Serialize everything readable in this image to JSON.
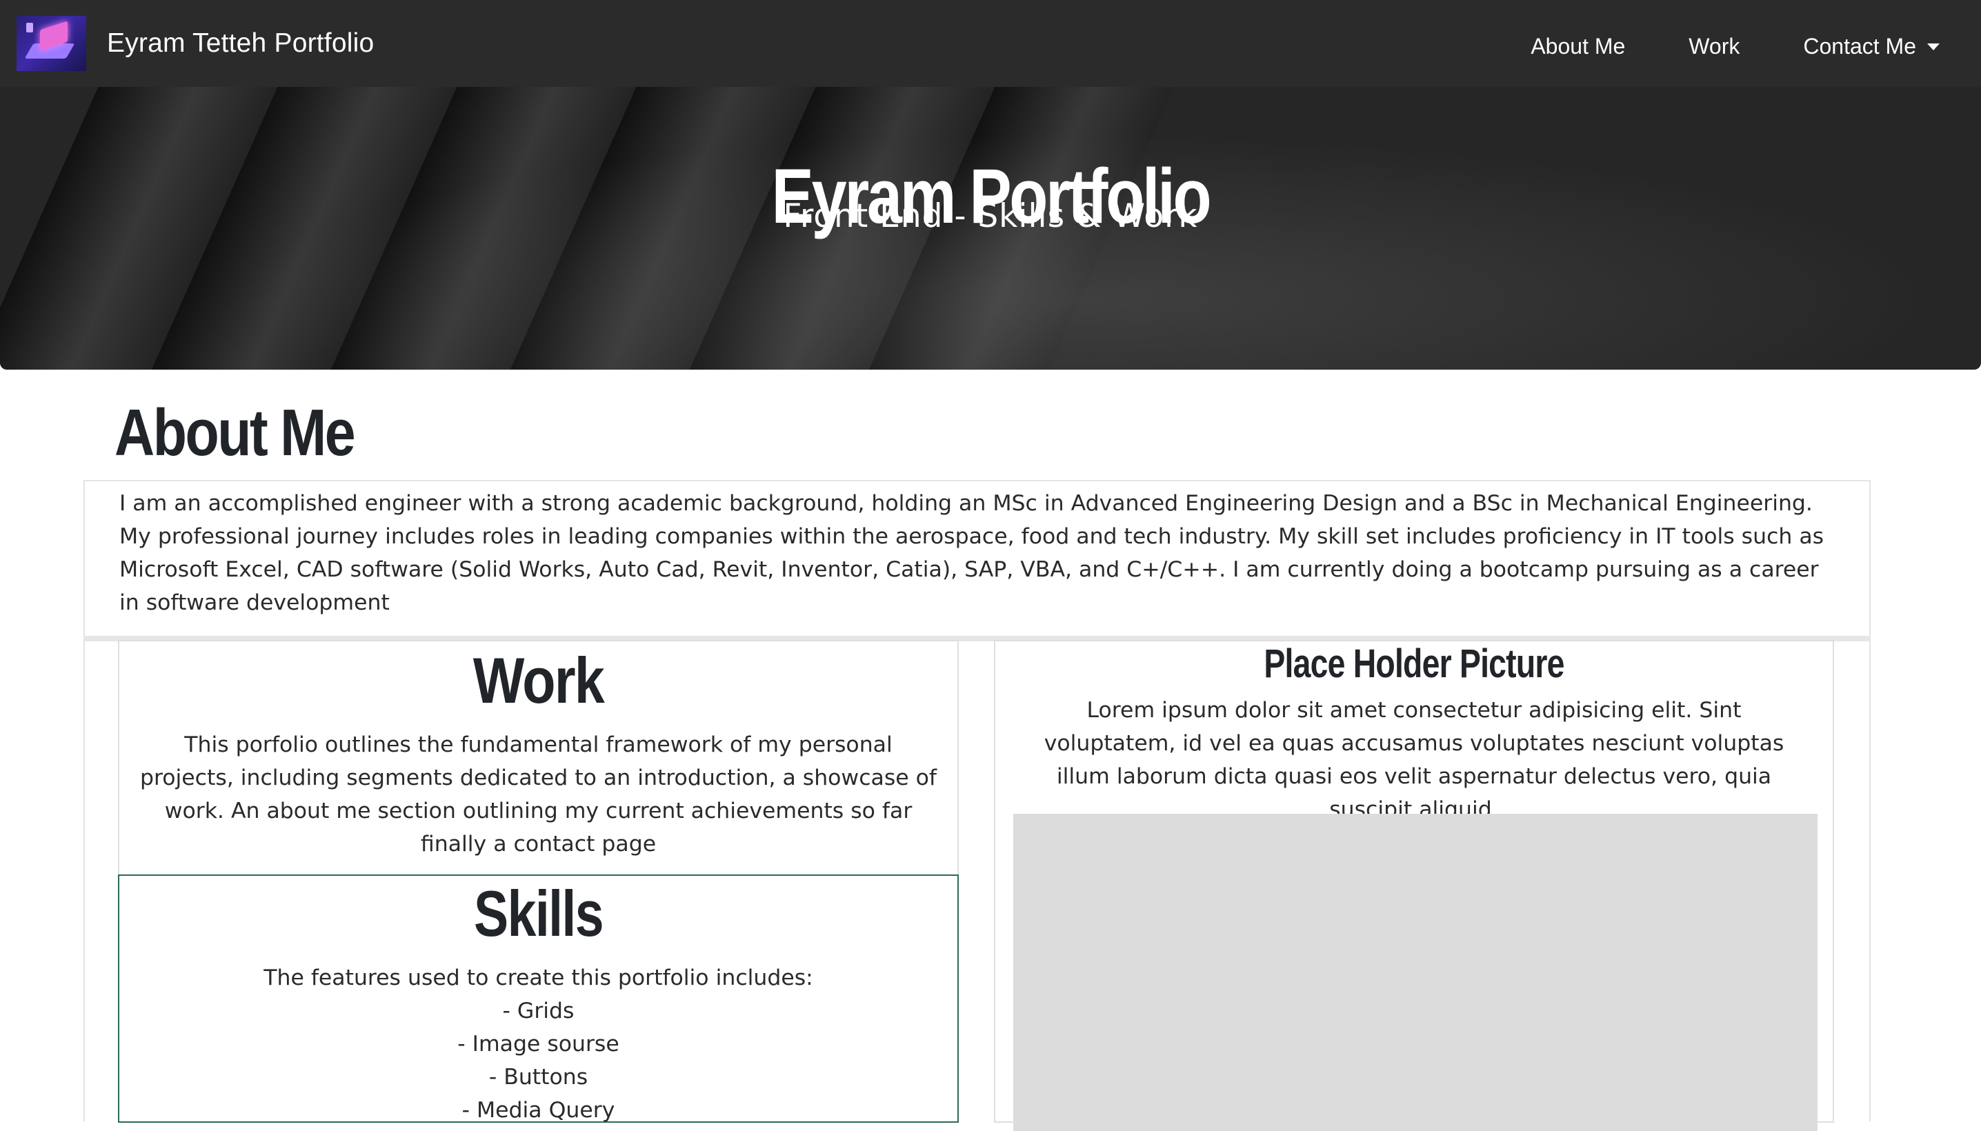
{
  "navbar": {
    "brand": "Eyram Tetteh Portfolio",
    "links": [
      "About Me",
      "Work",
      "Contact Me"
    ],
    "logo_icon": "laptop-logo-icon"
  },
  "hero": {
    "title": "Eyram Portfolio",
    "subtitle": "Front End - Skills & Work"
  },
  "about": {
    "heading": "About Me",
    "text": "I am an accomplished engineer with a strong academic background, holding an MSc in Advanced Engineering Design and a BSc in Mechanical Engineering. My professional journey includes roles in leading companies within the aerospace, food and tech industry. My skill set includes proficiency in IT tools such as Microsoft Excel, CAD software (Solid Works, Auto Cad, Revit, Inventor, Catia), SAP, VBA, and C+/C++. I am currently doing a bootcamp pursuing as a career in software development"
  },
  "work": {
    "heading": "Work",
    "text": "This porfolio outlines the fundamental framework of my personal projects, including segments dedicated to an introduction, a showcase of work. An about me section outlining my current achievements so far finally a contact page"
  },
  "skills": {
    "heading": "Skills",
    "intro": "The features used to create this portfolio includes:",
    "items": [
      "- Grids",
      "- Image sourse",
      "- Buttons",
      "- Media Query"
    ]
  },
  "picture": {
    "heading": "Place Holder Picture",
    "text": "Lorem ipsum dolor sit amet consectetur adipisicing elit. Sint voluptatem, id vel ea quas accusamus voluptates nesciunt voluptas illum laborum dicta quasi eos velit aspernatur delectus vero, quia suscipit aliquid."
  },
  "colors": {
    "navbar_bg": "#2b2b2b",
    "hero_bg": "#262626",
    "skills_border": "#2e6b52",
    "placeholder_bg": "#dcdcdc"
  }
}
